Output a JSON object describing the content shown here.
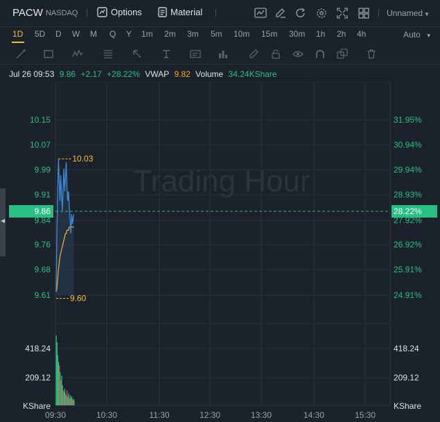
{
  "header": {
    "symbol": "PACW",
    "exchange": "NASDAQ",
    "options_label": "Options",
    "material_label": "Material",
    "layout_name": "Unnamed",
    "icons": [
      "chart-icon",
      "edit-icon",
      "refresh-icon",
      "settings-icon",
      "fullscreen-icon",
      "layout-grid-icon"
    ]
  },
  "periods": {
    "items": [
      "1D",
      "5D",
      "D",
      "W",
      "M",
      "Q",
      "Y",
      "1m",
      "2m",
      "3m",
      "5m",
      "10m",
      "15m",
      "30m",
      "1h",
      "2h",
      "4h"
    ],
    "active": "1D",
    "scale_mode": "Auto"
  },
  "drawing_tools": [
    "line-tool-icon",
    "rectangle-tool-icon",
    "wave-tool-icon",
    "fib-tool-icon",
    "arrow-tool-icon",
    "text-tool-icon",
    "annotation-tool-icon",
    "measure-tool-icon",
    "pen-tool-icon",
    "lock-icon",
    "eye-icon",
    "magnet-icon",
    "clone-icon",
    "trash-icon"
  ],
  "quote": {
    "datetime": "Jul 26 09:53",
    "price": "9.86",
    "change": "+2.17",
    "change_pct": "+28.22%",
    "vwap_label": "VWAP",
    "vwap": "9.82",
    "volume_label": "Volume",
    "volume": "34.24KShare"
  },
  "colors": {
    "up": "#27c082",
    "price_line": "#3d8bd9",
    "vwap_line": "#f5a623",
    "highlight_value": "#f2c230",
    "background": "#1c222b"
  },
  "chart_data": {
    "type": "line",
    "watermark": "Trading Hour",
    "x_ticks": [
      "09:30",
      "10:30",
      "11:30",
      "12:30",
      "13:30",
      "14:30",
      "15:30"
    ],
    "price_ticks": [
      "10.15",
      "10.07",
      "9.99",
      "9.91",
      "9.84",
      "9.76",
      "9.68",
      "9.61"
    ],
    "pct_ticks": [
      "31.95%",
      "30.94%",
      "29.94%",
      "28.93%",
      "27.92%",
      "26.92%",
      "25.91%",
      "24.91%"
    ],
    "current_price_label": "9.86",
    "current_pct_label": "28.22%",
    "high_label": "10.03",
    "low_label": "9.60",
    "ylim": [
      9.55,
      10.2
    ],
    "price_series": {
      "name": "Price",
      "minutes": [
        0,
        1,
        2,
        3,
        4,
        5,
        6,
        7,
        8,
        9,
        10,
        11,
        12,
        13,
        14,
        15,
        16,
        17,
        18,
        19,
        20,
        21,
        22,
        23
      ],
      "values": [
        9.62,
        9.8,
        9.93,
        10.03,
        9.96,
        9.9,
        9.98,
        9.92,
        9.87,
        9.94,
        10.0,
        9.93,
        9.97,
        10.02,
        9.94,
        9.9,
        9.93,
        9.88,
        9.84,
        9.8,
        9.86,
        9.83,
        9.85,
        9.86
      ]
    },
    "vwap_series": {
      "name": "VWAP",
      "minutes": [
        0,
        1,
        2,
        3,
        4,
        5,
        6,
        7,
        8,
        9,
        10,
        11,
        12,
        13,
        14,
        15,
        16,
        17,
        18,
        19,
        20,
        21,
        22,
        23
      ],
      "values": [
        9.62,
        9.63,
        9.66,
        9.69,
        9.71,
        9.73,
        9.74,
        9.75,
        9.76,
        9.77,
        9.78,
        9.79,
        9.8,
        9.8,
        9.81,
        9.81,
        9.81,
        9.82,
        9.82,
        9.82,
        9.82,
        9.82,
        9.82,
        9.82
      ]
    },
    "volume_ticks": [
      "418.24",
      "209.12"
    ],
    "volume_unit": "KShare",
    "volume_series": {
      "name": "Volume",
      "minutes": [
        0,
        1,
        2,
        3,
        4,
        5,
        6,
        7,
        8,
        9,
        10,
        11,
        12,
        13,
        14,
        15,
        16,
        17,
        18,
        19,
        20,
        21,
        22,
        23
      ],
      "values": [
        420,
        380,
        300,
        260,
        240,
        200,
        150,
        180,
        120,
        90,
        80,
        100,
        70,
        60,
        90,
        50,
        70,
        40,
        60,
        45,
        55,
        35,
        40,
        30
      ],
      "up": [
        true,
        true,
        true,
        true,
        false,
        true,
        false,
        true,
        true,
        false,
        true,
        true,
        false,
        true,
        false,
        true,
        true,
        false,
        true,
        false,
        true,
        false,
        true,
        true
      ]
    }
  }
}
